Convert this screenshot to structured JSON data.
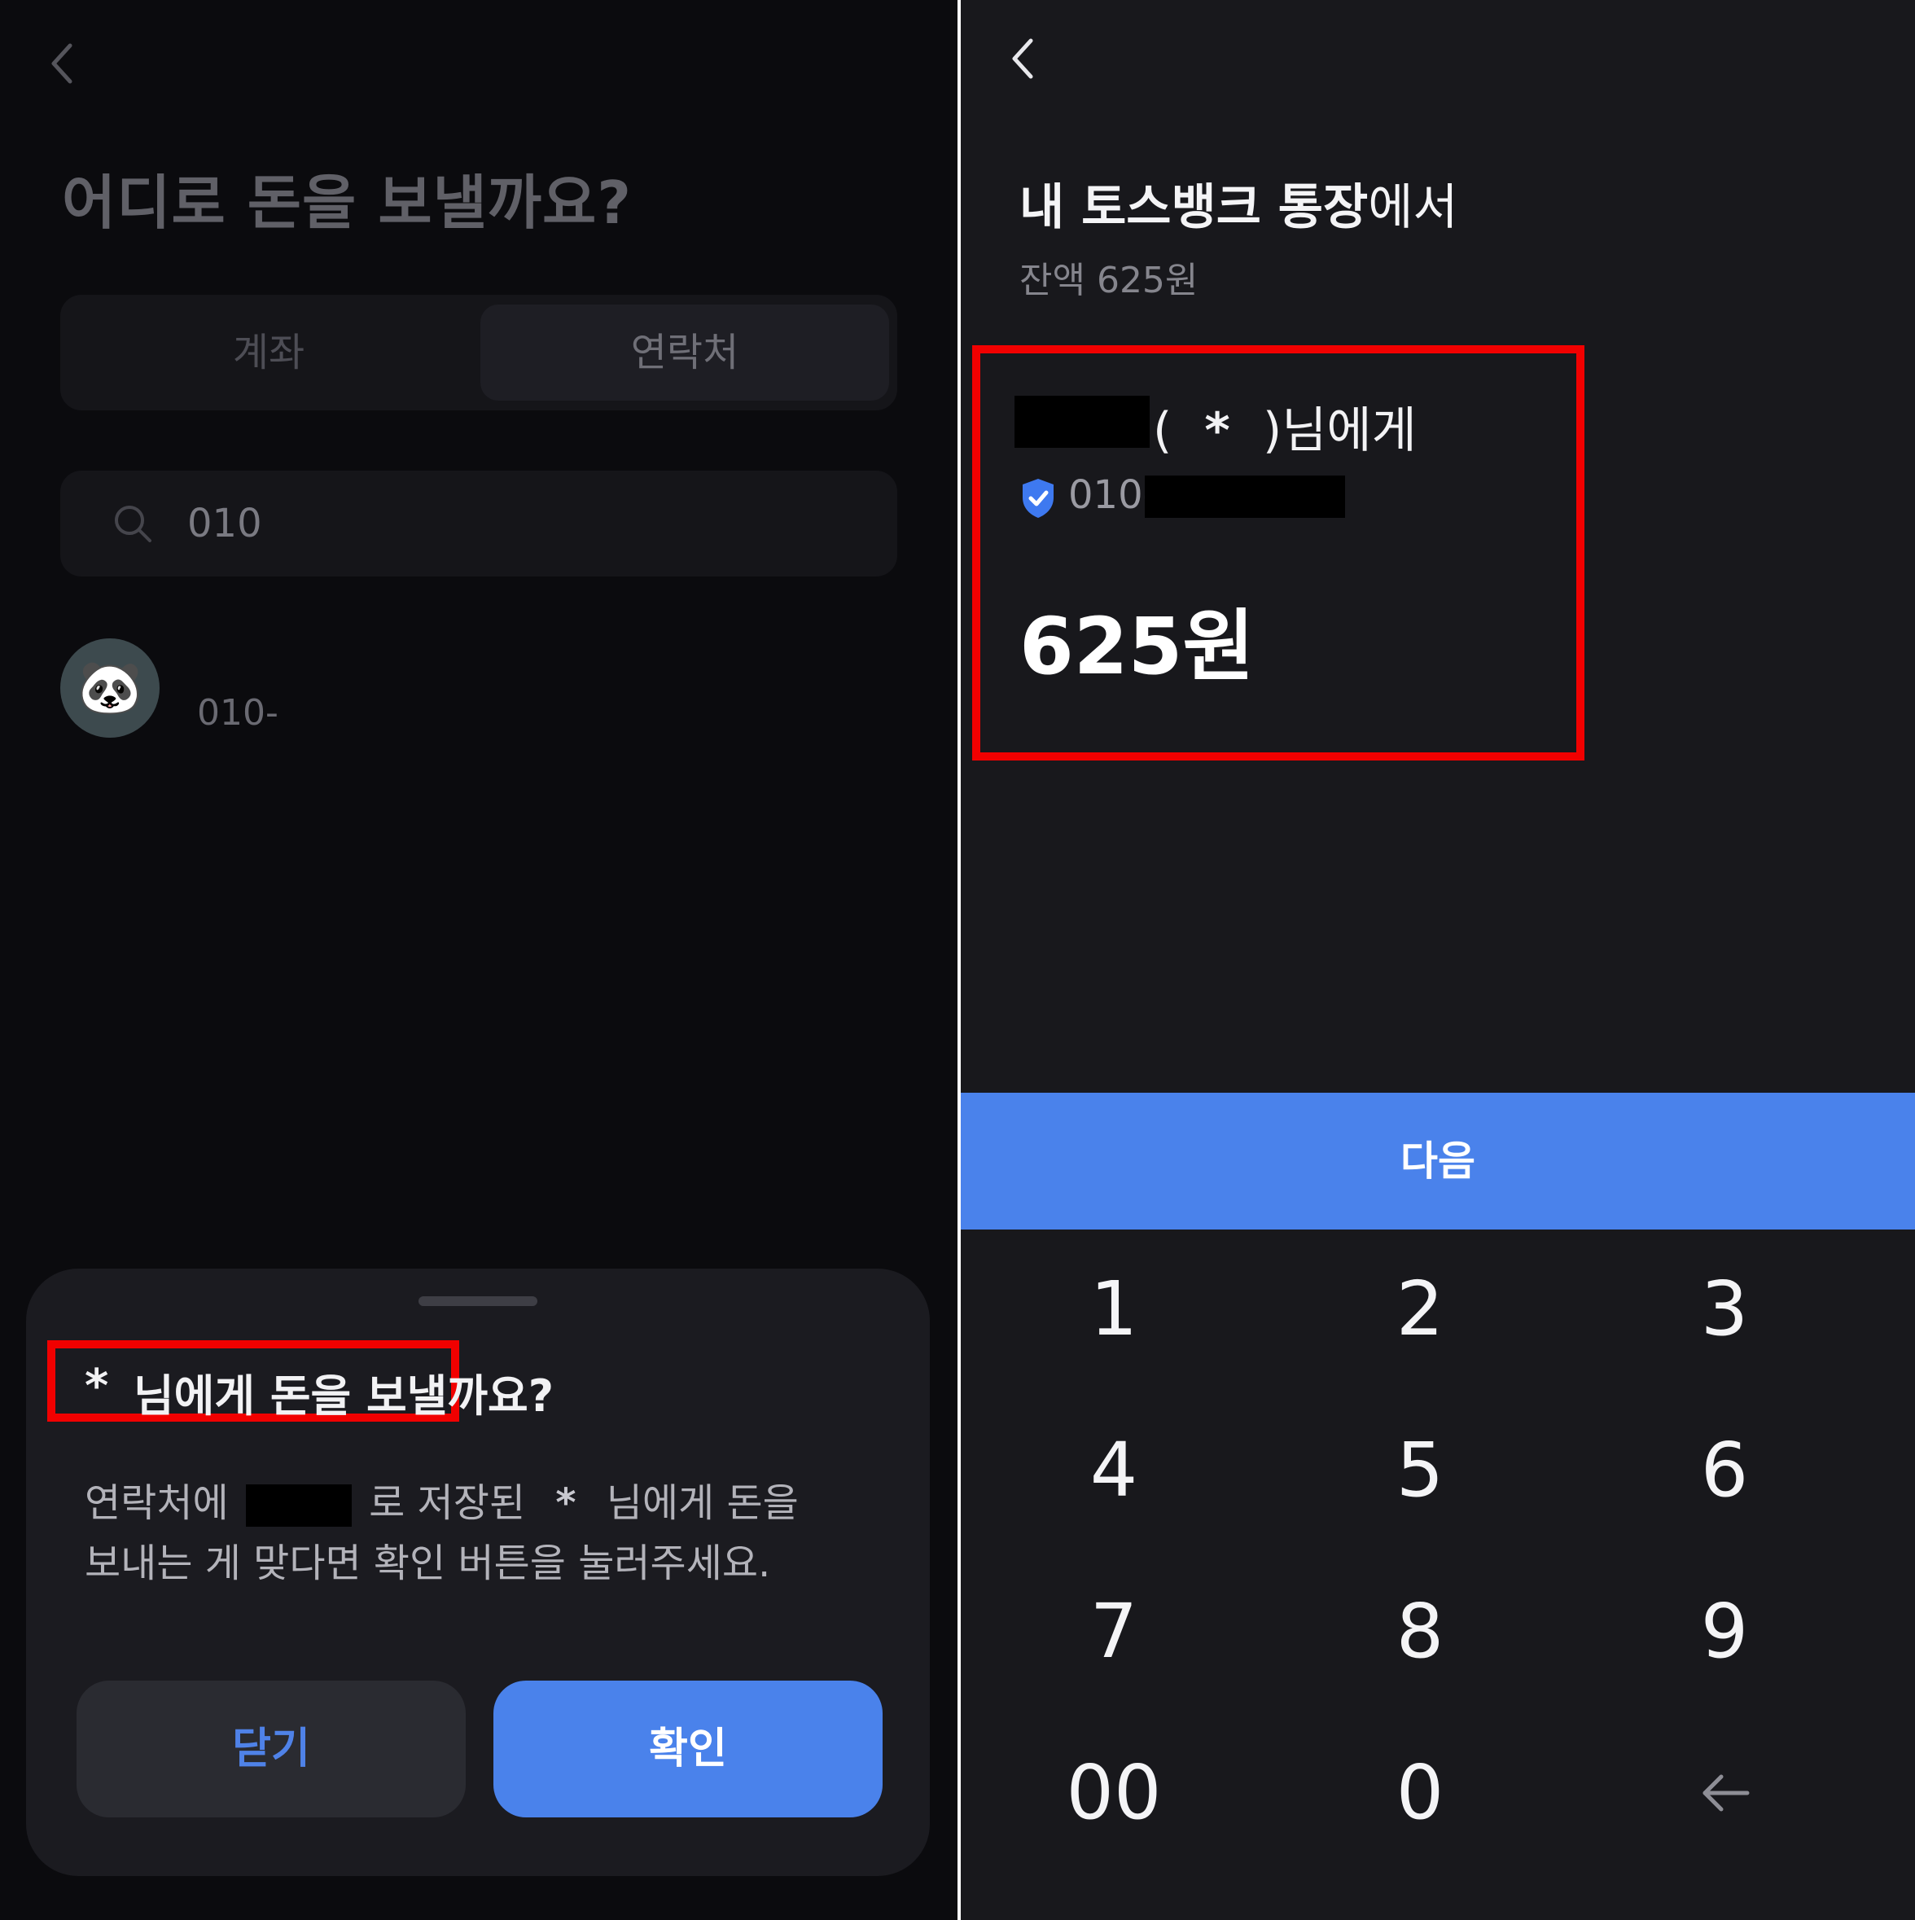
{
  "left_screen": {
    "title": "어디로 돈을 보낼까요?",
    "tabs": [
      {
        "label": "계좌",
        "selected": false
      },
      {
        "label": "연락처",
        "selected": true
      }
    ],
    "search": {
      "value": "010"
    },
    "contact": {
      "phone_prefix": "010-",
      "avatar": "🐼"
    },
    "sheet": {
      "title_star": "*",
      "title_text": "님에게 돈을 보낼까요?",
      "desc_line1_a": "연락처에",
      "desc_line1_b": "로 저장된",
      "desc_line1_star": "*",
      "desc_line1_c": "님에게 돈을",
      "desc_line2": "보내는 게 맞다면 확인 버튼을 눌러주세요.",
      "close_label": "닫기",
      "confirm_label": "확인"
    }
  },
  "right_screen": {
    "title_bold": "내 토스뱅크 통장",
    "title_rest": "에서",
    "balance": "잔액 625원",
    "recipient_open": "(",
    "recipient_star": "*",
    "recipient_close": ")님에게",
    "phone_prefix": "010-",
    "amount": "625원",
    "next_label": "다음",
    "keypad": [
      "1",
      "2",
      "3",
      "4",
      "5",
      "6",
      "7",
      "8",
      "9",
      "00",
      "0"
    ]
  },
  "colors": {
    "accent_blue": "#4a82eb",
    "highlight_red": "#f10000",
    "verified_badge": "#3e79f0"
  },
  "icons": [
    "back-chevron-icon",
    "search-icon",
    "verified-shield-icon",
    "backspace-arrow-icon"
  ]
}
